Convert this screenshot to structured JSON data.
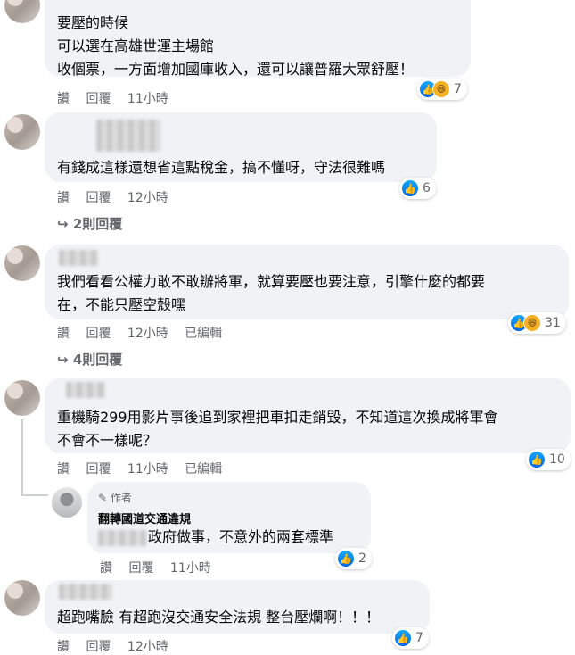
{
  "comments": [
    {
      "lines": [
        "要壓的時候",
        "可以選在高雄世運主場館",
        "收個票，一方面增加國庫收入，還可以讓普羅大眾舒壓！"
      ],
      "actions": {
        "like": "讚",
        "reply": "回覆",
        "time": "11小時"
      },
      "reaction_count": "7",
      "reactions": [
        "like",
        "haha"
      ]
    },
    {
      "lines": [
        "有錢成這樣還想省這點稅金，搞不懂呀，守法很難嗎"
      ],
      "actions": {
        "like": "讚",
        "reply": "回覆",
        "time": "12小時"
      },
      "reaction_count": "6",
      "reactions": [
        "like"
      ],
      "replies": "2則回覆"
    },
    {
      "lines": [
        "我們看看公權力敢不敢辦將軍，就算要壓也要注意，引擎什麼的都要",
        "在，不能只壓空殼嘿"
      ],
      "actions": {
        "like": "讚",
        "reply": "回覆",
        "time": "12小時",
        "edited": "已編輯"
      },
      "reaction_count": "31",
      "reactions": [
        "like",
        "haha"
      ],
      "replies": "4則回覆"
    },
    {
      "lines": [
        "重機騎299用影片事後追到家裡把車扣走銷毀，不知道這次換成將軍會",
        "不會不一樣呢？"
      ],
      "actions": {
        "like": "讚",
        "reply": "回覆",
        "time": "11小時",
        "edited": "已編輯"
      },
      "reaction_count": "10",
      "reactions": [
        "like"
      ]
    },
    {
      "lines": [
        "超跑嘴臉 有超跑沒交通安全法規 整台壓爛啊！！！"
      ],
      "actions": {
        "like": "讚",
        "reply": "回覆",
        "time": "12小時"
      },
      "reaction_count": "7",
      "reactions": [
        "like"
      ]
    }
  ],
  "author_reply": {
    "badge": "作者",
    "name": "翻轉國道交通違規",
    "text": "政府做事，不意外的兩套標準",
    "actions": {
      "like": "讚",
      "reply": "回覆",
      "time": "11小時"
    },
    "reaction_count": "2",
    "reactions": [
      "like"
    ]
  },
  "icons": {
    "like": "thumbs-up-icon",
    "haha": "laughing-face-icon",
    "reply_arrow": "reply-arrow-icon",
    "pencil": "pencil-icon"
  },
  "colors": {
    "bubble": "#f0f2f5",
    "secondary_text": "#65676b",
    "like_blue": "#0866ff",
    "haha_yellow": "#f7b125"
  }
}
